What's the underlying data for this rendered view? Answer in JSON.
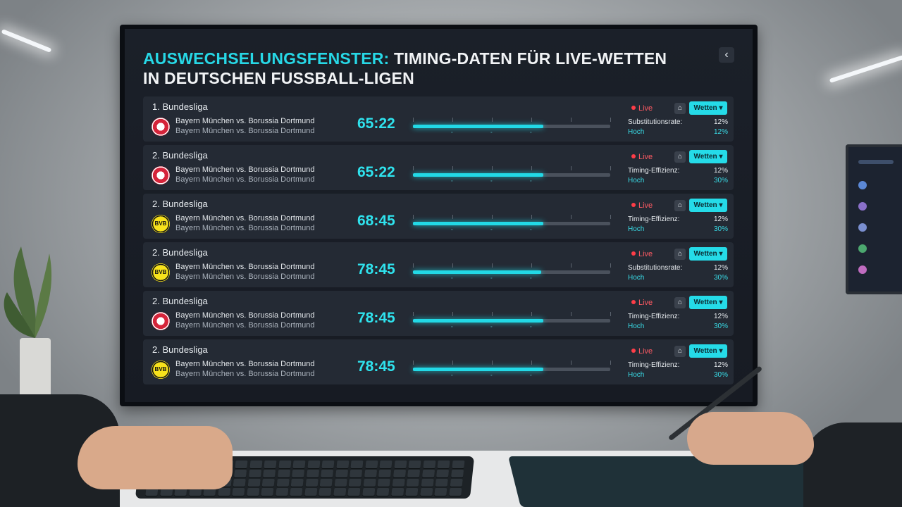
{
  "title": {
    "accent": "AUSWECHSELUNGSFENSTER:",
    "rest": " TIMING-DATEN FÜR LIVE-WETTEN IN DEUTSCHEN FUSSBALL-LIGEN"
  },
  "back_icon": "chevron-left-icon",
  "matches": [
    {
      "league": "1. Bundesliga",
      "logo": "bayern",
      "line1": "Bayern München vs. Borussia Dortmund",
      "line2": "Bayern München vs. Borussia Dortmund",
      "time": "65:22",
      "progress": 0.66,
      "live": "Live",
      "bet": "Wetten ▾",
      "stat_label": "Substitutionsrate:",
      "stat_value": "12%",
      "stat_label2": "Hoch",
      "stat_value2": "12%"
    },
    {
      "league": "2. Bundesliga",
      "logo": "bayern",
      "line1": "Bayern München vs. Borussia Dortmund",
      "line2": "Bayern München vs. Borussia Dortmund",
      "time": "65:22",
      "progress": 0.66,
      "live": "Live",
      "bet": "Wetten ▾",
      "stat_label": "Timing-Effizienz:",
      "stat_value": "12%",
      "stat_label2": "Hoch",
      "stat_value2": "30%"
    },
    {
      "league": "2. Bundesliga",
      "logo": "bvb",
      "line1": "Bayern München vs. Borussia Dortmund",
      "line2": "Bayern München vs. Borussia Dortmund",
      "time": "68:45",
      "progress": 0.66,
      "live": "Live",
      "bet": "Wetten ▾",
      "stat_label": "Timing-Effizienz:",
      "stat_value": "12%",
      "stat_label2": "Hoch",
      "stat_value2": "30%"
    },
    {
      "league": "2. Bundesliga",
      "logo": "bvb",
      "line1": "Bayern München vs. Borussia Dortmund",
      "line2": "Bayern München vs. Borussia Dortmund",
      "time": "78:45",
      "progress": 0.65,
      "live": "Live",
      "bet": "Wetten ▾",
      "stat_label": "Substitutionsrate:",
      "stat_value": "12%",
      "stat_label2": "Hoch",
      "stat_value2": "30%"
    },
    {
      "league": "2. Bundesliga",
      "logo": "bayern",
      "line1": "Bayern München vs. Borussia Dortmund",
      "line2": "Bayern München vs. Borussia Dortmund",
      "time": "78:45",
      "progress": 0.66,
      "live": "Live",
      "bet": "Wetten ▾",
      "stat_label": "Timing-Effizienz:",
      "stat_value": "12%",
      "stat_label2": "Hoch",
      "stat_value2": "30%"
    },
    {
      "league": "2. Bundesliga",
      "logo": "bvb",
      "line1": "Bayern München vs. Borussia Dortmund",
      "line2": "Bayern München vs. Borussia Dortmund",
      "time": "78:45",
      "progress": 0.66,
      "live": "Live",
      "bet": "Wetten ▾",
      "stat_label": "Timing-Effizienz:",
      "stat_value": "12%",
      "stat_label2": "Hoch",
      "stat_value2": "30%"
    }
  ]
}
